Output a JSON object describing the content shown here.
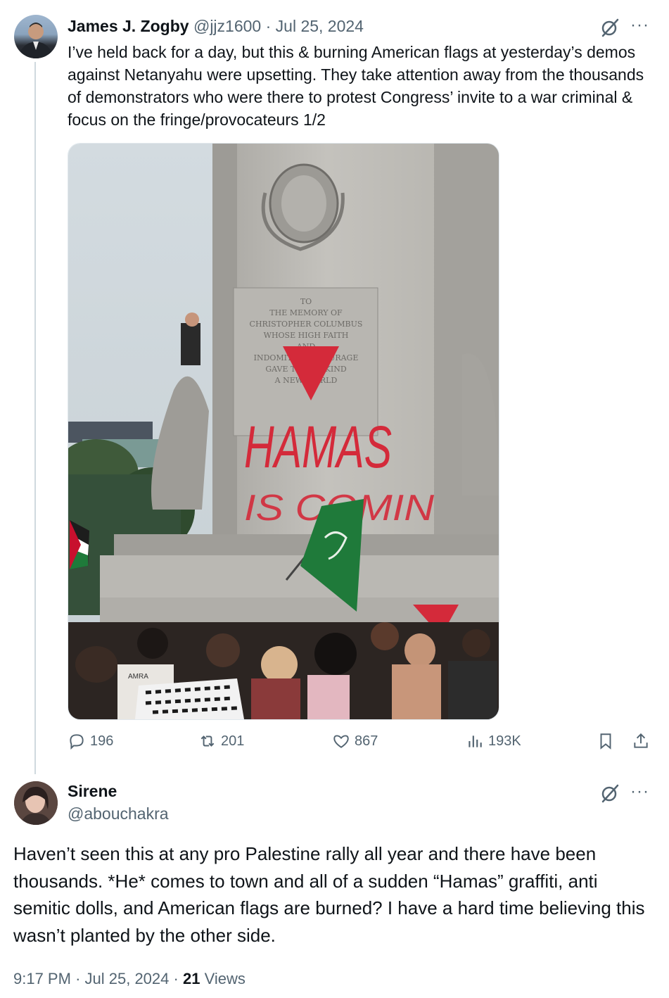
{
  "tweet": {
    "author_name": "James J. Zogby",
    "author_handle": "@jjz1600",
    "separator": "·",
    "date": "Jul 25, 2024",
    "text": "I’ve held back for a day, but this & burning American flags at yesterday’s demos against Netanyahu were upsetting. They take attention away from the thousands of demonstrators who were there to protest Congress’ invite to a war criminal & focus on the fringe/provocateurs 1/2",
    "image": {
      "engraving_lines": [
        "TO",
        "THE MEMORY OF",
        "CHRISTOPHER COLUMBUS",
        "WHOSE HIGH FAITH",
        "AND",
        "INDOMITABLE COURAGE",
        "GAVE TO MANKIND",
        "A NEW WORLD"
      ],
      "graffiti_main": "HAMAS",
      "graffiti_second": "IS COMIN",
      "shirt_text": "AMRA"
    },
    "stats": {
      "replies": "196",
      "retweets": "201",
      "likes": "867",
      "views": "193K"
    },
    "more_label": "···"
  },
  "reply": {
    "author_name": "Sirene",
    "author_handle": "@abouchakra",
    "text": "Haven’t seen this at any pro Palestine rally all year and there have been thousands. *He* comes to town and all of a sudden “Hamas” graffiti, anti semitic dolls, and American flags are burned? I have a hard time believing this wasn’t planted by the other side.",
    "time": "9:17 PM",
    "separator": "·",
    "date": "Jul 25, 2024",
    "views_count": "21",
    "views_label": "Views",
    "more_label": "···"
  },
  "colors": {
    "text": "#0f1419",
    "secondary": "#536471",
    "thread_line": "#cfd9de",
    "graffiti_red": "#d42a3a",
    "flag_green": "#1f7a3a"
  },
  "icons": [
    "grok-icon",
    "more-icon",
    "reply-icon",
    "retweet-icon",
    "like-icon",
    "views-icon",
    "bookmark-icon",
    "share-icon",
    "alt-text-icon"
  ]
}
